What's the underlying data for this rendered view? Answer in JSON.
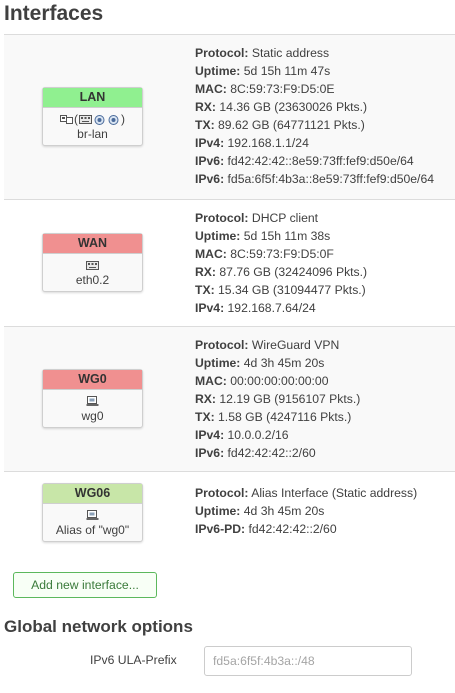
{
  "page": {
    "title": "Interfaces"
  },
  "interfaces": [
    {
      "name": "LAN",
      "color": "#90f090",
      "device": "br-lan",
      "icons": [
        "bridge-icon",
        "ethernet-port-icon",
        "wifi-icon",
        "wifi-icon"
      ],
      "details": [
        {
          "label": "Protocol:",
          "value": "Static address"
        },
        {
          "label": "Uptime:",
          "value": "5d 15h 11m 47s"
        },
        {
          "label": "MAC:",
          "value": "8C:59:73:F9:D5:0E"
        },
        {
          "label": "RX:",
          "value": "14.36 GB (23630026 Pkts.)"
        },
        {
          "label": "TX:",
          "value": "89.62 GB (64771121 Pkts.)"
        },
        {
          "label": "IPv4:",
          "value": "192.168.1.1/24"
        },
        {
          "label": "IPv6:",
          "value": "fd42:42:42::8e59:73ff:fef9:d50e/64"
        },
        {
          "label": "IPv6:",
          "value": "fd5a:6f5f:4b3a::8e59:73ff:fef9:d50e/64"
        }
      ]
    },
    {
      "name": "WAN",
      "color": "#f09090",
      "device": "eth0.2",
      "icons": [
        "ethernet-port-icon"
      ],
      "details": [
        {
          "label": "Protocol:",
          "value": "DHCP client"
        },
        {
          "label": "Uptime:",
          "value": "5d 15h 11m 38s"
        },
        {
          "label": "MAC:",
          "value": "8C:59:73:F9:D5:0F"
        },
        {
          "label": "RX:",
          "value": "87.76 GB (32424096 Pkts.)"
        },
        {
          "label": "TX:",
          "value": "15.34 GB (31094477 Pkts.)"
        },
        {
          "label": "IPv4:",
          "value": "192.168.7.64/24"
        }
      ]
    },
    {
      "name": "WG0",
      "color": "#f09090",
      "device": "wg0",
      "icons": [
        "tunnel-icon"
      ],
      "details": [
        {
          "label": "Protocol:",
          "value": "WireGuard VPN"
        },
        {
          "label": "Uptime:",
          "value": "4d 3h 45m 20s"
        },
        {
          "label": "MAC:",
          "value": "00:00:00:00:00:00"
        },
        {
          "label": "RX:",
          "value": "12.19 GB (9156107 Pkts.)"
        },
        {
          "label": "TX:",
          "value": "1.58 GB (4247116 Pkts.)"
        },
        {
          "label": "IPv4:",
          "value": "10.0.0.2/16"
        },
        {
          "label": "IPv6:",
          "value": "fd42:42:42::2/60"
        }
      ]
    },
    {
      "name": "WG06",
      "color": "#c8e6a8",
      "device": "Alias of \"wg0\"",
      "icons": [
        "tunnel-icon"
      ],
      "details": [
        {
          "label": "Protocol:",
          "value": "Alias Interface (Static address)"
        },
        {
          "label": "Uptime:",
          "value": "4d 3h 45m 20s"
        },
        {
          "label": "IPv6-PD:",
          "value": "fd42:42:42::2/60"
        }
      ]
    }
  ],
  "add_button": {
    "label": "Add new interface..."
  },
  "global": {
    "title": "Global network options",
    "ula_label": "IPv6 ULA-Prefix",
    "ula_value": "",
    "ula_placeholder": "fd5a:6f5f:4b3a::/48"
  }
}
